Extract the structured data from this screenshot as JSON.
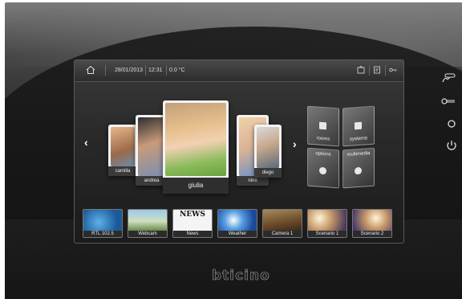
{
  "status_bar": {
    "date": "28/01/2013",
    "time": "12:31",
    "temperature": "0.0 °C",
    "icons": [
      "home-icon",
      "photo-frame-icon",
      "memo-icon",
      "key-icon"
    ]
  },
  "carousel": {
    "items": [
      {
        "label": "camilla"
      },
      {
        "label": "andrea"
      },
      {
        "label": "giulia"
      },
      {
        "label": "nino"
      },
      {
        "label": "diego"
      }
    ],
    "selected": "giulia"
  },
  "tiles": [
    {
      "label": "rooms"
    },
    {
      "label": "systems"
    },
    {
      "label": "options"
    },
    {
      "label": "multimedia"
    }
  ],
  "shortcuts": [
    {
      "label": "RTL 102.5"
    },
    {
      "label": "Webcam"
    },
    {
      "label": "News",
      "header": "NEWS"
    },
    {
      "label": "Weather"
    },
    {
      "label": "Camera 1"
    },
    {
      "label": "Scenario 1"
    },
    {
      "label": "Scenario 2"
    }
  ],
  "side_buttons": [
    "answer-icon",
    "key-icon",
    "circle-icon",
    "power-icon"
  ],
  "brand": "bticino",
  "colors": {
    "accent": "#ffffff",
    "bezel": "#1e1e1e"
  }
}
